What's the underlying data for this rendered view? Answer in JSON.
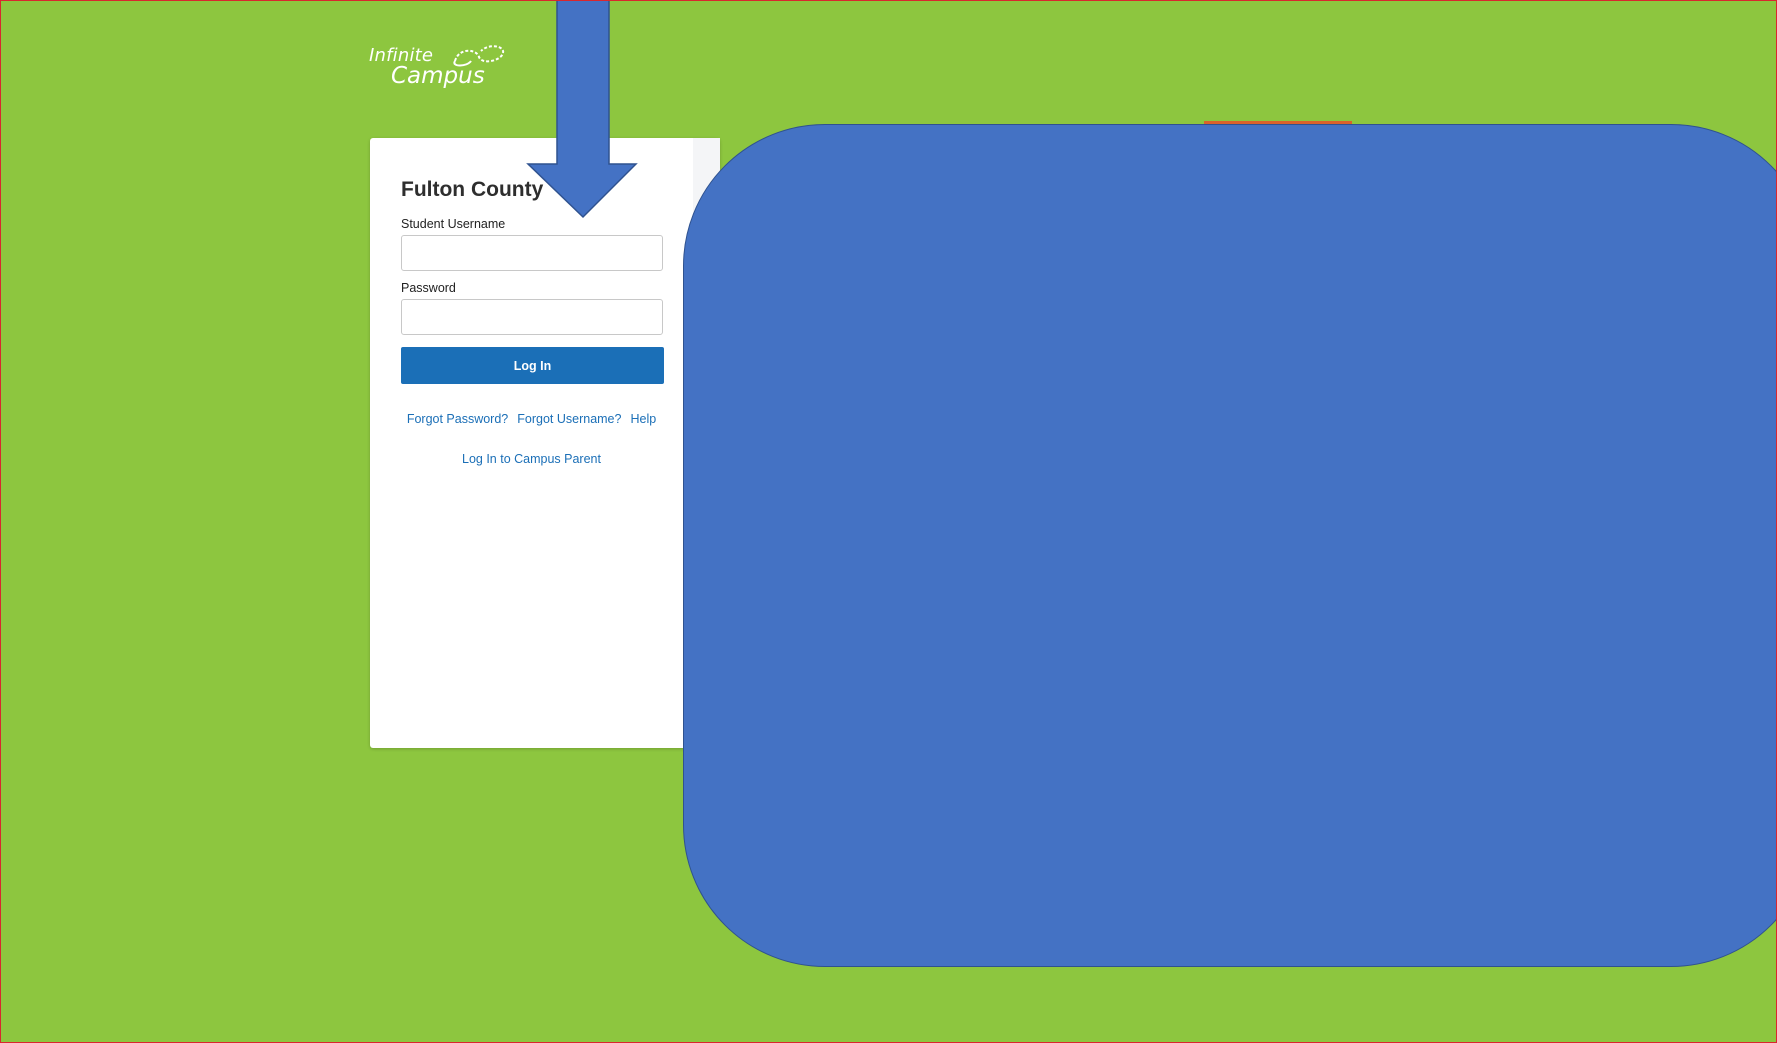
{
  "brand": {
    "logo_line1": "Infinite",
    "logo_line2": "Campus"
  },
  "login": {
    "district": "Fulton County",
    "username_label": "Student Username",
    "username_value": "",
    "password_label": "Password",
    "password_value": "",
    "login_button": "Log In",
    "links": {
      "forgot_password": "Forgot Password?",
      "forgot_username": "Forgot Username?",
      "help": "Help"
    },
    "parent_link": "Log In to Campus Parent"
  },
  "colors": {
    "background": "#8dc63f",
    "primary": "#1b6fb7",
    "overlay": "#4472c4",
    "overlay_border": "#2f528f",
    "frame_border": "#d9272e"
  },
  "icons": {
    "logo_mark": "infinity-swoosh-icon",
    "annotation_arrow": "down-arrow-icon"
  }
}
